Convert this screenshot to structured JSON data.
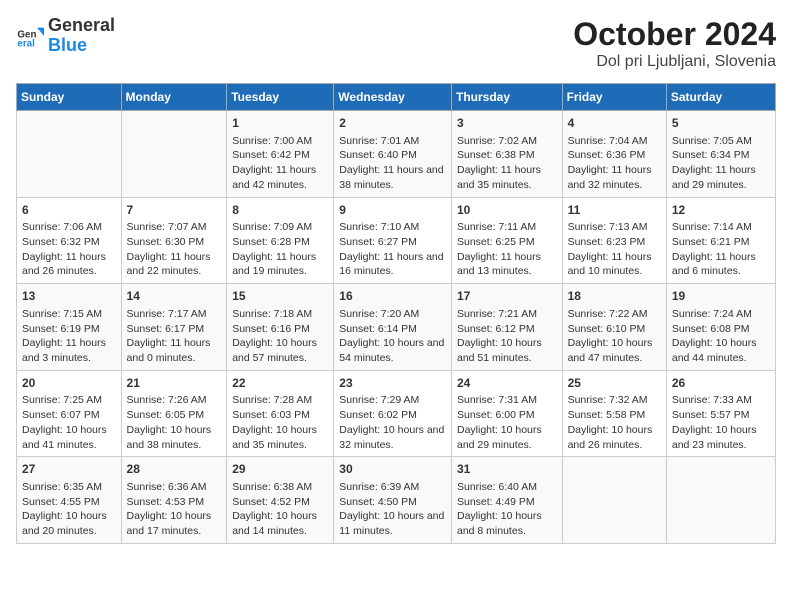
{
  "header": {
    "logo_general": "General",
    "logo_blue": "Blue",
    "title": "October 2024",
    "subtitle": "Dol pri Ljubljani, Slovenia"
  },
  "days_of_week": [
    "Sunday",
    "Monday",
    "Tuesday",
    "Wednesday",
    "Thursday",
    "Friday",
    "Saturday"
  ],
  "weeks": [
    [
      {
        "day": "",
        "info": ""
      },
      {
        "day": "",
        "info": ""
      },
      {
        "day": "1",
        "info": "Sunrise: 7:00 AM\nSunset: 6:42 PM\nDaylight: 11 hours and 42 minutes."
      },
      {
        "day": "2",
        "info": "Sunrise: 7:01 AM\nSunset: 6:40 PM\nDaylight: 11 hours and 38 minutes."
      },
      {
        "day": "3",
        "info": "Sunrise: 7:02 AM\nSunset: 6:38 PM\nDaylight: 11 hours and 35 minutes."
      },
      {
        "day": "4",
        "info": "Sunrise: 7:04 AM\nSunset: 6:36 PM\nDaylight: 11 hours and 32 minutes."
      },
      {
        "day": "5",
        "info": "Sunrise: 7:05 AM\nSunset: 6:34 PM\nDaylight: 11 hours and 29 minutes."
      }
    ],
    [
      {
        "day": "6",
        "info": "Sunrise: 7:06 AM\nSunset: 6:32 PM\nDaylight: 11 hours and 26 minutes."
      },
      {
        "day": "7",
        "info": "Sunrise: 7:07 AM\nSunset: 6:30 PM\nDaylight: 11 hours and 22 minutes."
      },
      {
        "day": "8",
        "info": "Sunrise: 7:09 AM\nSunset: 6:28 PM\nDaylight: 11 hours and 19 minutes."
      },
      {
        "day": "9",
        "info": "Sunrise: 7:10 AM\nSunset: 6:27 PM\nDaylight: 11 hours and 16 minutes."
      },
      {
        "day": "10",
        "info": "Sunrise: 7:11 AM\nSunset: 6:25 PM\nDaylight: 11 hours and 13 minutes."
      },
      {
        "day": "11",
        "info": "Sunrise: 7:13 AM\nSunset: 6:23 PM\nDaylight: 11 hours and 10 minutes."
      },
      {
        "day": "12",
        "info": "Sunrise: 7:14 AM\nSunset: 6:21 PM\nDaylight: 11 hours and 6 minutes."
      }
    ],
    [
      {
        "day": "13",
        "info": "Sunrise: 7:15 AM\nSunset: 6:19 PM\nDaylight: 11 hours and 3 minutes."
      },
      {
        "day": "14",
        "info": "Sunrise: 7:17 AM\nSunset: 6:17 PM\nDaylight: 11 hours and 0 minutes."
      },
      {
        "day": "15",
        "info": "Sunrise: 7:18 AM\nSunset: 6:16 PM\nDaylight: 10 hours and 57 minutes."
      },
      {
        "day": "16",
        "info": "Sunrise: 7:20 AM\nSunset: 6:14 PM\nDaylight: 10 hours and 54 minutes."
      },
      {
        "day": "17",
        "info": "Sunrise: 7:21 AM\nSunset: 6:12 PM\nDaylight: 10 hours and 51 minutes."
      },
      {
        "day": "18",
        "info": "Sunrise: 7:22 AM\nSunset: 6:10 PM\nDaylight: 10 hours and 47 minutes."
      },
      {
        "day": "19",
        "info": "Sunrise: 7:24 AM\nSunset: 6:08 PM\nDaylight: 10 hours and 44 minutes."
      }
    ],
    [
      {
        "day": "20",
        "info": "Sunrise: 7:25 AM\nSunset: 6:07 PM\nDaylight: 10 hours and 41 minutes."
      },
      {
        "day": "21",
        "info": "Sunrise: 7:26 AM\nSunset: 6:05 PM\nDaylight: 10 hours and 38 minutes."
      },
      {
        "day": "22",
        "info": "Sunrise: 7:28 AM\nSunset: 6:03 PM\nDaylight: 10 hours and 35 minutes."
      },
      {
        "day": "23",
        "info": "Sunrise: 7:29 AM\nSunset: 6:02 PM\nDaylight: 10 hours and 32 minutes."
      },
      {
        "day": "24",
        "info": "Sunrise: 7:31 AM\nSunset: 6:00 PM\nDaylight: 10 hours and 29 minutes."
      },
      {
        "day": "25",
        "info": "Sunrise: 7:32 AM\nSunset: 5:58 PM\nDaylight: 10 hours and 26 minutes."
      },
      {
        "day": "26",
        "info": "Sunrise: 7:33 AM\nSunset: 5:57 PM\nDaylight: 10 hours and 23 minutes."
      }
    ],
    [
      {
        "day": "27",
        "info": "Sunrise: 6:35 AM\nSunset: 4:55 PM\nDaylight: 10 hours and 20 minutes."
      },
      {
        "day": "28",
        "info": "Sunrise: 6:36 AM\nSunset: 4:53 PM\nDaylight: 10 hours and 17 minutes."
      },
      {
        "day": "29",
        "info": "Sunrise: 6:38 AM\nSunset: 4:52 PM\nDaylight: 10 hours and 14 minutes."
      },
      {
        "day": "30",
        "info": "Sunrise: 6:39 AM\nSunset: 4:50 PM\nDaylight: 10 hours and 11 minutes."
      },
      {
        "day": "31",
        "info": "Sunrise: 6:40 AM\nSunset: 4:49 PM\nDaylight: 10 hours and 8 minutes."
      },
      {
        "day": "",
        "info": ""
      },
      {
        "day": "",
        "info": ""
      }
    ]
  ]
}
